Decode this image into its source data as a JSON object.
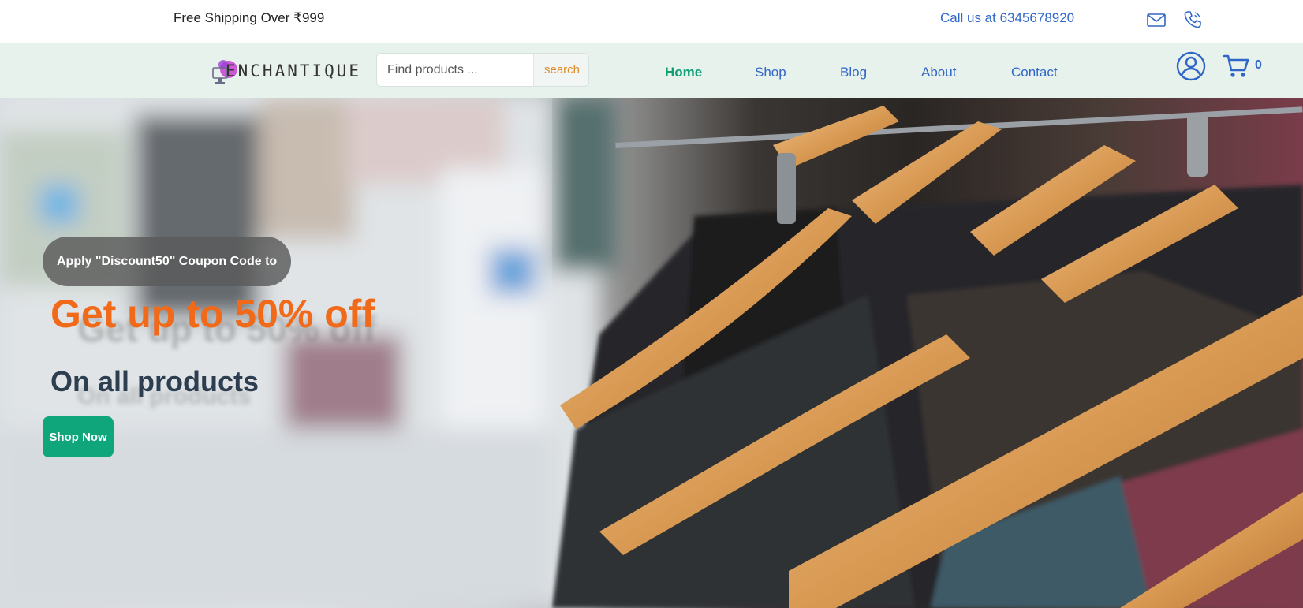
{
  "topbar": {
    "shipping_text": "Free Shipping Over ₹999",
    "call_text": "Call us at 6345678920",
    "icons": [
      "mail-icon",
      "phone-icon"
    ]
  },
  "navbar": {
    "logo_text": "ENCHANTIQUE",
    "search": {
      "placeholder": "Find products ...",
      "value": "",
      "button_label": "search"
    },
    "links": [
      {
        "label": "Home",
        "active": true
      },
      {
        "label": "Shop",
        "active": false
      },
      {
        "label": "Blog",
        "active": false
      },
      {
        "label": "About",
        "active": false
      },
      {
        "label": "Contact",
        "active": false
      }
    ],
    "cart_count": "0",
    "icons": [
      "user-icon",
      "cart-icon"
    ]
  },
  "hero": {
    "coupon_text": "Apply \"Discount50\" Coupon Code to",
    "headline": "Get up to 50% off",
    "subhead": "On all products",
    "cta_label": "Shop Now"
  },
  "colors": {
    "accent_orange": "#f06a1a",
    "accent_green": "#0fa67b",
    "link_blue": "#2f66c8",
    "nav_bg": "#e8f2ec"
  }
}
